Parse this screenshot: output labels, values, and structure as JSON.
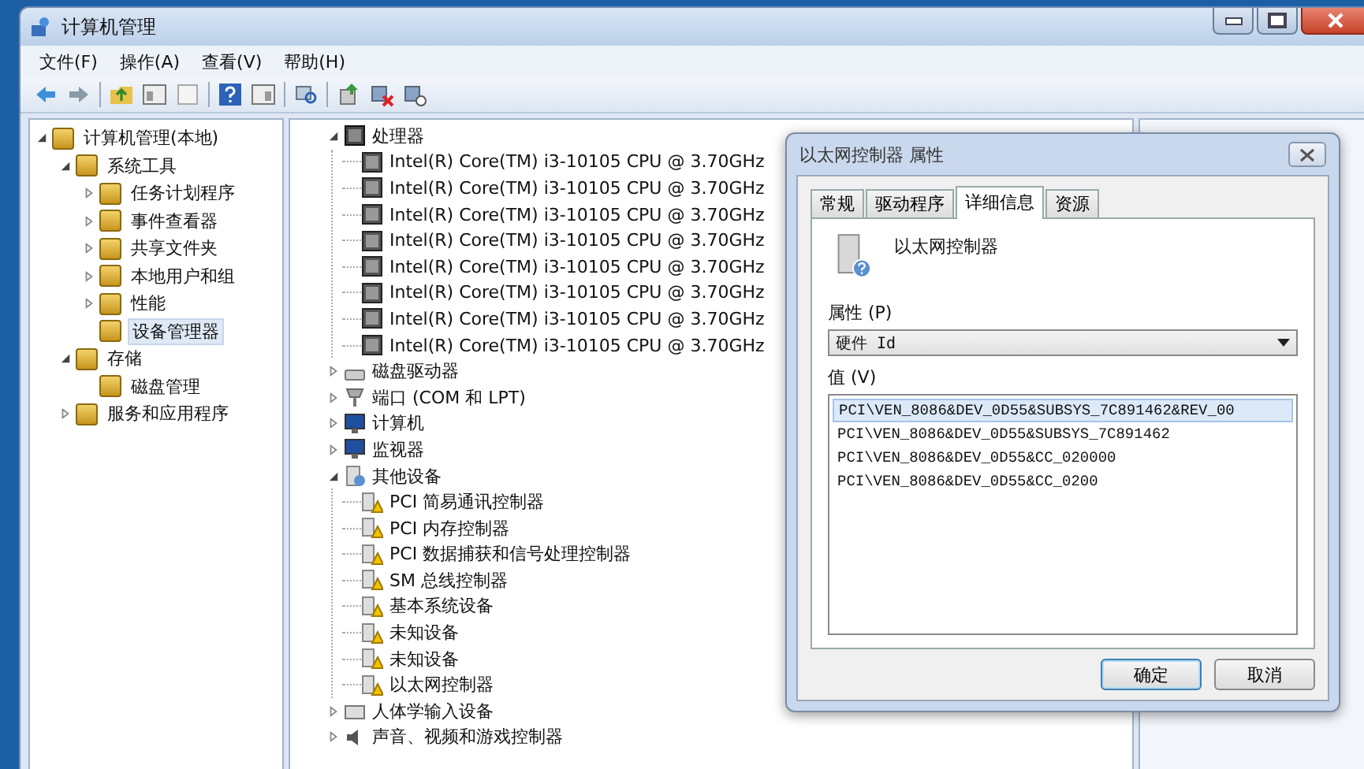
{
  "window": {
    "title": "计算机管理"
  },
  "menu": [
    "文件(F)",
    "操作(A)",
    "查看(V)",
    "帮助(H)"
  ],
  "nav_tree": [
    {
      "label": "计算机管理(本地)",
      "expanded": true,
      "selected": false,
      "children": [
        {
          "label": "系统工具",
          "expanded": true,
          "selected": false,
          "children": [
            {
              "label": "任务计划程序",
              "expanded": false,
              "selected": false
            },
            {
              "label": "事件查看器",
              "expanded": false,
              "selected": false
            },
            {
              "label": "共享文件夹",
              "expanded": false,
              "selected": false
            },
            {
              "label": "本地用户和组",
              "expanded": false,
              "selected": false
            },
            {
              "label": "性能",
              "expanded": false,
              "selected": false
            },
            {
              "label": "设备管理器",
              "selected": true
            }
          ]
        },
        {
          "label": "存储",
          "expanded": true,
          "selected": false,
          "children": [
            {
              "label": "磁盘管理",
              "selected": false
            }
          ]
        },
        {
          "label": "服务和应用程序",
          "expanded": false,
          "selected": false
        }
      ]
    }
  ],
  "device_tree": [
    {
      "label": "处理器",
      "kind": "processor",
      "expanded": true,
      "children": [
        {
          "label": "Intel(R) Core(TM) i3-10105 CPU @ 3.70GHz",
          "kind": "chip"
        },
        {
          "label": "Intel(R) Core(TM) i3-10105 CPU @ 3.70GHz",
          "kind": "chip"
        },
        {
          "label": "Intel(R) Core(TM) i3-10105 CPU @ 3.70GHz",
          "kind": "chip"
        },
        {
          "label": "Intel(R) Core(TM) i3-10105 CPU @ 3.70GHz",
          "kind": "chip"
        },
        {
          "label": "Intel(R) Core(TM) i3-10105 CPU @ 3.70GHz",
          "kind": "chip"
        },
        {
          "label": "Intel(R) Core(TM) i3-10105 CPU @ 3.70GHz",
          "kind": "chip"
        },
        {
          "label": "Intel(R) Core(TM) i3-10105 CPU @ 3.70GHz",
          "kind": "chip"
        },
        {
          "label": "Intel(R) Core(TM) i3-10105 CPU @ 3.70GHz",
          "kind": "chip"
        }
      ]
    },
    {
      "label": "磁盘驱动器",
      "kind": "disk",
      "expanded": false
    },
    {
      "label": "端口 (COM 和 LPT)",
      "kind": "port",
      "expanded": false
    },
    {
      "label": "计算机",
      "kind": "computer",
      "expanded": false
    },
    {
      "label": "监视器",
      "kind": "monitor",
      "expanded": false
    },
    {
      "label": "其他设备",
      "kind": "unknown",
      "expanded": true,
      "children": [
        {
          "label": "PCI 简易通讯控制器",
          "kind": "warning"
        },
        {
          "label": "PCI 内存控制器",
          "kind": "warning"
        },
        {
          "label": "PCI 数据捕获和信号处理控制器",
          "kind": "warning"
        },
        {
          "label": "SM 总线控制器",
          "kind": "warning"
        },
        {
          "label": "基本系统设备",
          "kind": "warning"
        },
        {
          "label": "未知设备",
          "kind": "warning"
        },
        {
          "label": "未知设备",
          "kind": "warning"
        },
        {
          "label": "以太网控制器",
          "kind": "warning"
        }
      ]
    },
    {
      "label": "人体学输入设备",
      "kind": "input",
      "expanded": false
    },
    {
      "label": "声音、视频和游戏控制器",
      "kind": "sound",
      "expanded": false
    }
  ],
  "dialog": {
    "title": "以太网控制器 属性",
    "tabs": [
      {
        "label": "常规",
        "selected": false
      },
      {
        "label": "驱动程序",
        "selected": false
      },
      {
        "label": "详细信息",
        "selected": true
      },
      {
        "label": "资源",
        "selected": false
      }
    ],
    "device_name": "以太网控制器",
    "property_label": "属性 (P)",
    "property_value": "硬件 Id",
    "values_label": "值 (V)",
    "values": [
      {
        "text": "PCI\\VEN_8086&DEV_0D55&SUBSYS_7C891462&REV_00",
        "selected": true
      },
      {
        "text": "PCI\\VEN_8086&DEV_0D55&SUBSYS_7C891462",
        "selected": false
      },
      {
        "text": "PCI\\VEN_8086&DEV_0D55&CC_020000",
        "selected": false
      },
      {
        "text": "PCI\\VEN_8086&DEV_0D55&CC_0200",
        "selected": false
      }
    ],
    "buttons": [
      {
        "label": "确定",
        "default": true
      },
      {
        "label": "取消",
        "default": false
      }
    ]
  }
}
